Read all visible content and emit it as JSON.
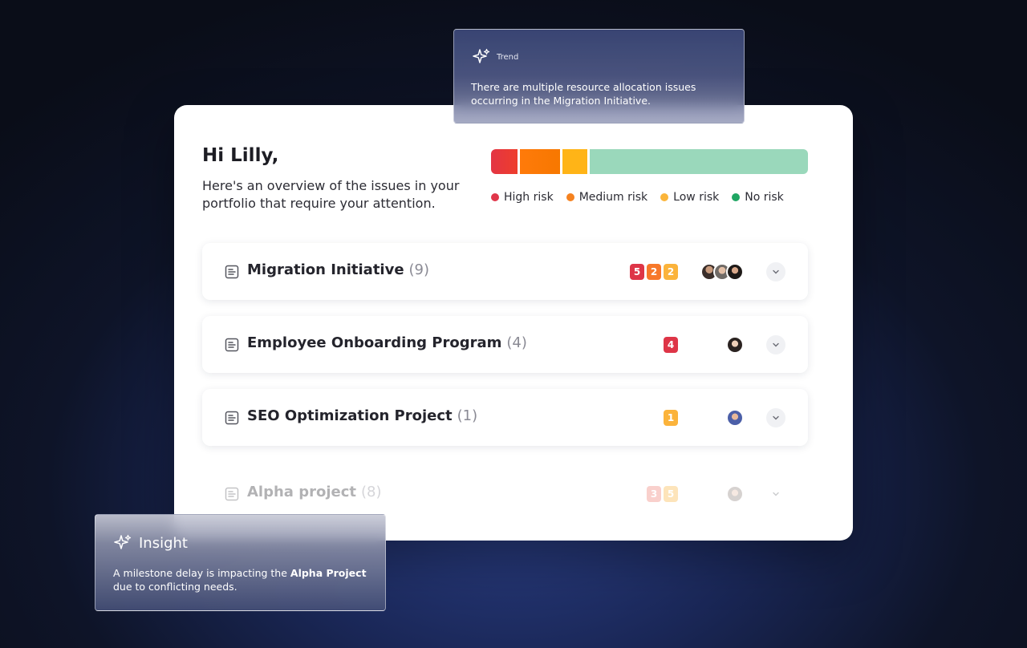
{
  "greeting": "Hi Lilly,",
  "subtitle": "Here's an overview of the issues in your portfolio that require your attention.",
  "risk_legend": [
    {
      "label": "High risk",
      "color": "#e0364a"
    },
    {
      "label": "Medium risk",
      "color": "#f5821f"
    },
    {
      "label": "Low risk",
      "color": "#fbb53a"
    },
    {
      "label": "No risk",
      "color": "#1fa663"
    }
  ],
  "projects": [
    {
      "name": "Migration Initiative",
      "count": "(9)",
      "badges": [
        {
          "value": "5",
          "level": "high"
        },
        {
          "value": "2",
          "level": "medium"
        },
        {
          "value": "2",
          "level": "low"
        }
      ]
    },
    {
      "name": "Employee Onboarding Program",
      "count": "(4)",
      "badges": [
        {
          "value": "4",
          "level": "high"
        }
      ]
    },
    {
      "name": "SEO Optimization Project",
      "count": "(1)",
      "badges": [
        {
          "value": "1",
          "level": "low"
        }
      ]
    },
    {
      "name": "Alpha project",
      "count": "(8)",
      "badges": [
        {
          "value": "3",
          "level": "high"
        },
        {
          "value": "5",
          "level": "low"
        }
      ]
    }
  ],
  "trend": {
    "label": "Trend",
    "text": "There are multiple resource allocation issues occurring in the Migration Initiative."
  },
  "insight": {
    "label": "Insight",
    "text_before": "A milestone delay is impacting the ",
    "text_bold": "Alpha Project",
    "text_after": " due to conflicting needs."
  }
}
